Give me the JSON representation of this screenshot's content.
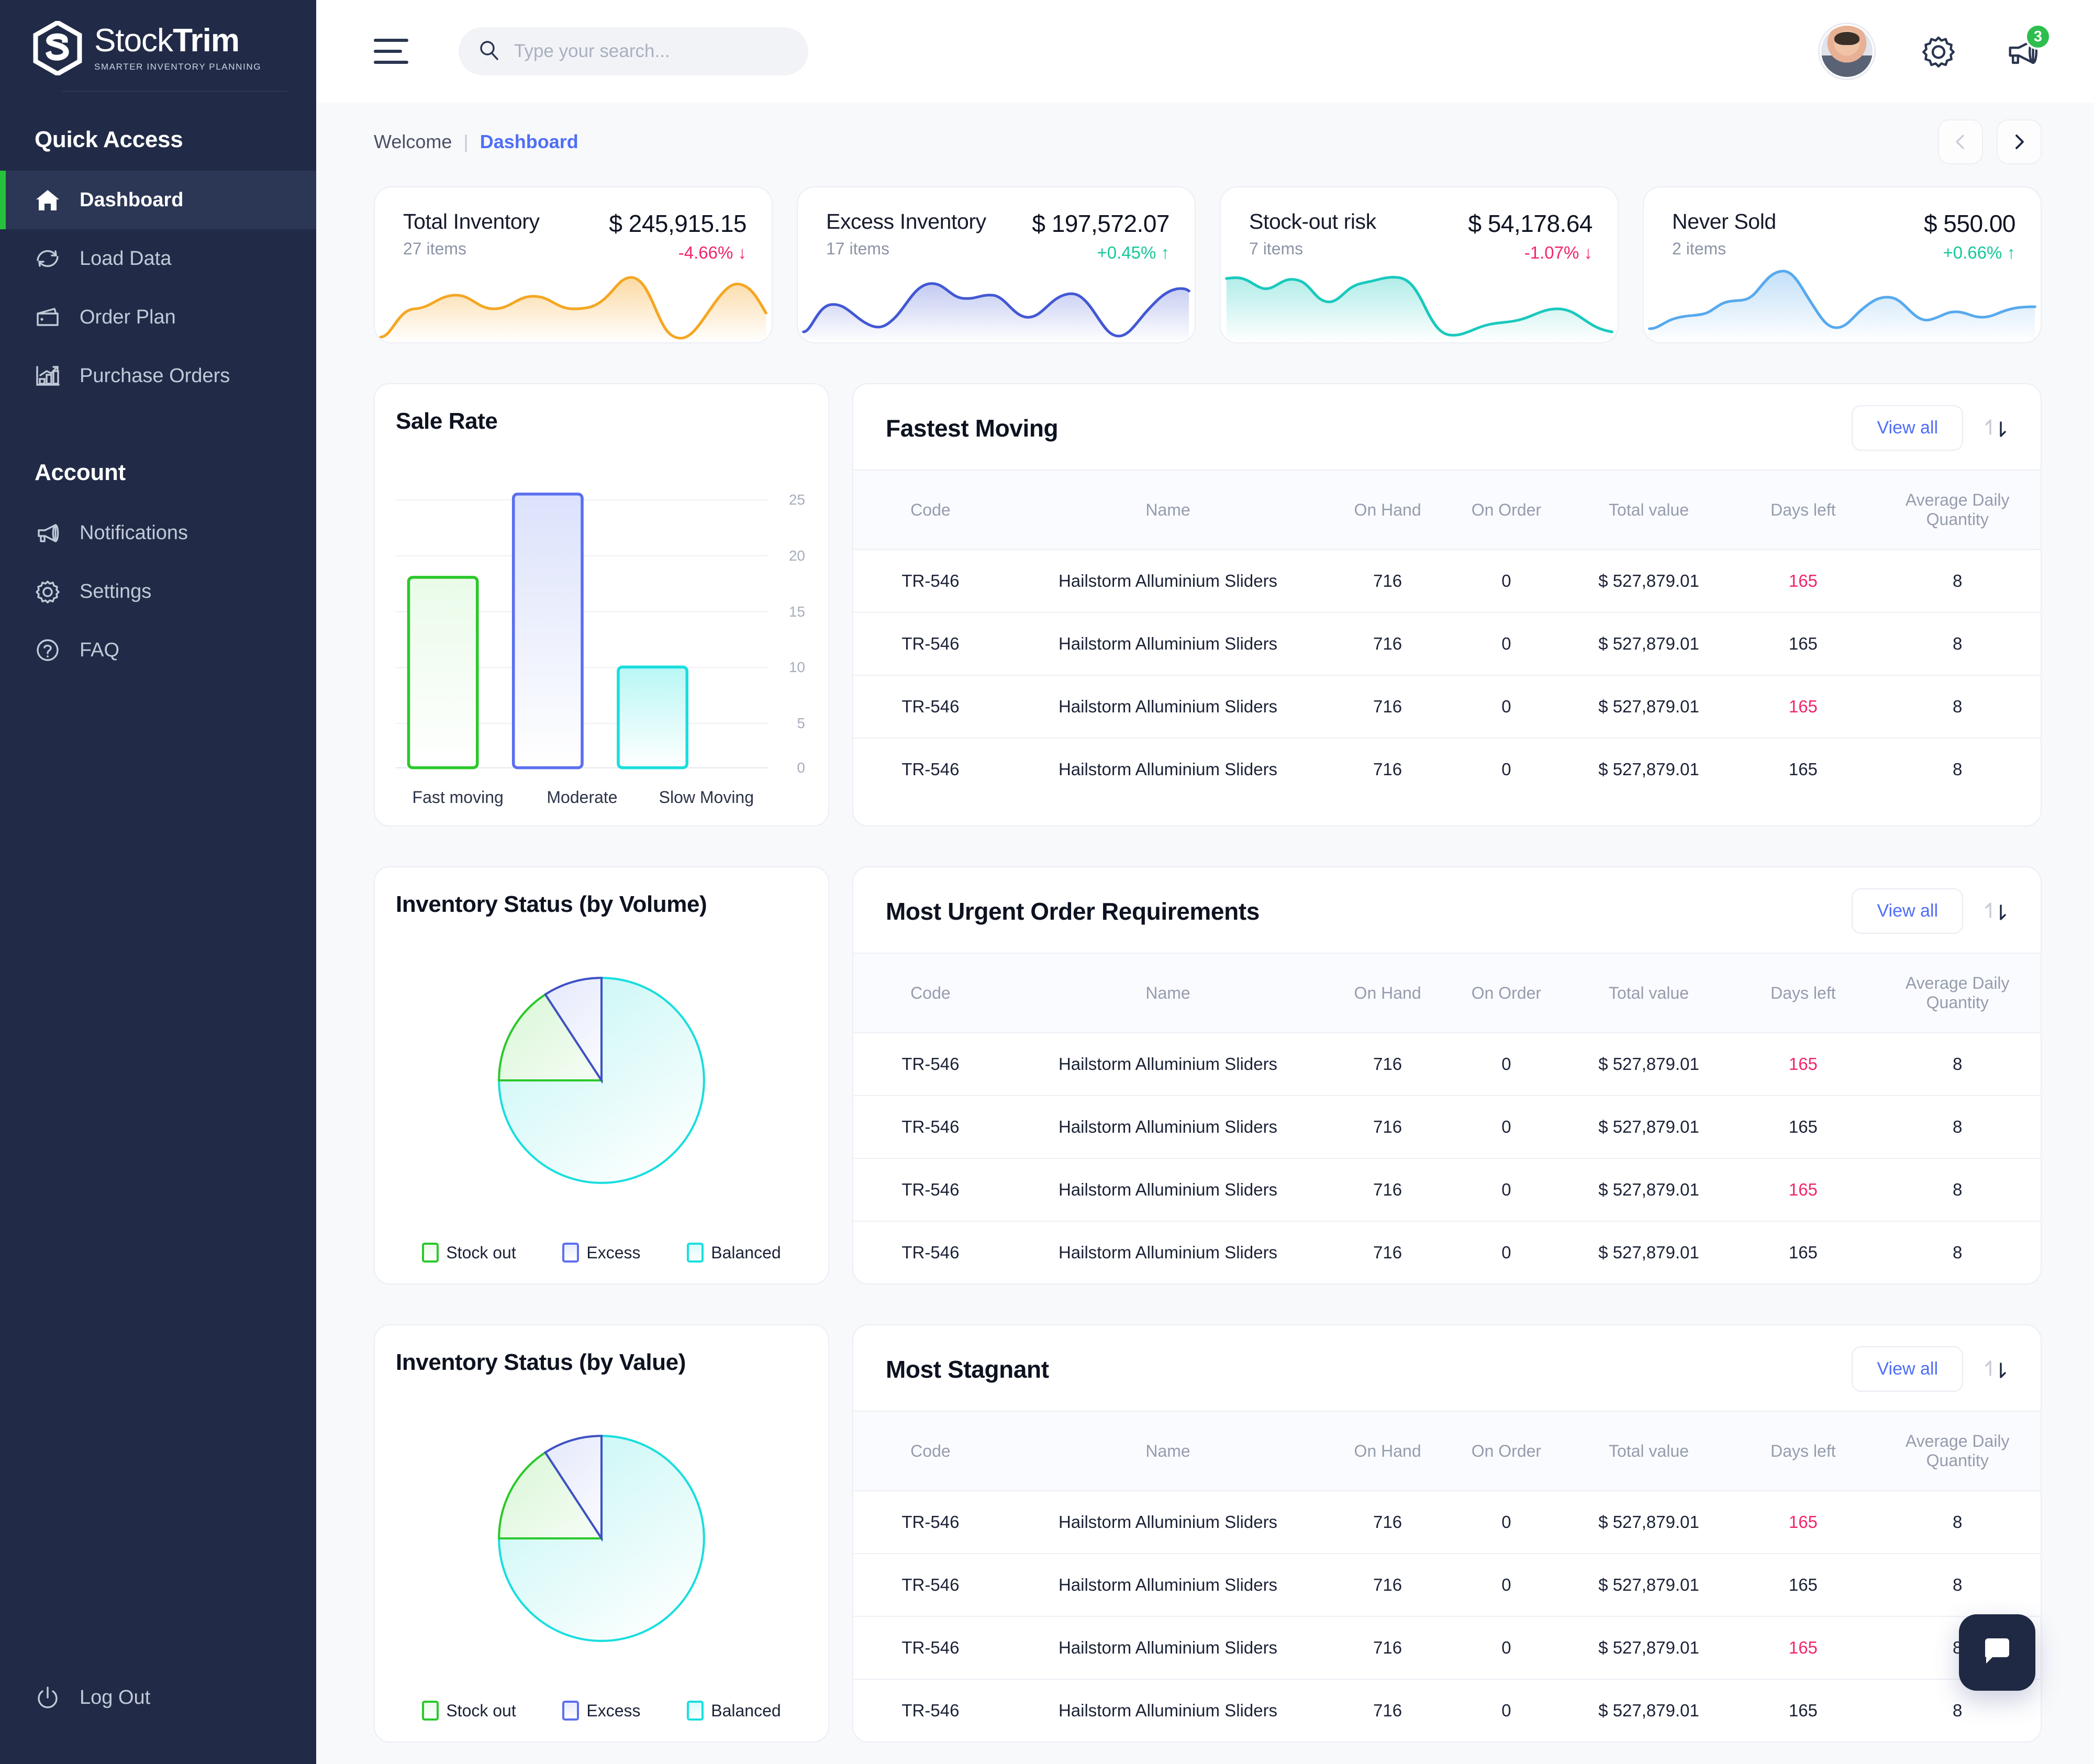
{
  "brand": {
    "name_light": "Stock",
    "name_bold": "Trim",
    "tagline": "SMARTER INVENTORY PLANNING"
  },
  "sidebar": {
    "quick_access_title": "Quick Access",
    "account_title": "Account",
    "quick_items": [
      {
        "label": "Dashboard",
        "icon": "home-icon",
        "active": true
      },
      {
        "label": "Load Data",
        "icon": "refresh-icon",
        "active": false
      },
      {
        "label": "Order Plan",
        "icon": "wallet-icon",
        "active": false
      },
      {
        "label": "Purchase Orders",
        "icon": "bar-chart-icon",
        "active": false
      }
    ],
    "account_items": [
      {
        "label": "Notifications",
        "icon": "megaphone-icon"
      },
      {
        "label": "Settings",
        "icon": "gear-icon"
      },
      {
        "label": "FAQ",
        "icon": "question-icon"
      }
    ],
    "logout_label": "Log Out"
  },
  "topbar": {
    "search_placeholder": "Type your search...",
    "search_value": "",
    "notification_count": "3"
  },
  "breadcrumb": {
    "welcome": "Welcome",
    "separator": "|",
    "current": "Dashboard"
  },
  "kpis": [
    {
      "title": "Total Inventory",
      "items": "27 items",
      "value": "$ 245,915.15",
      "delta": "-4.66% ↓",
      "delta_dir": "down",
      "color": "#f5a623"
    },
    {
      "title": "Excess Inventory",
      "items": "17 items",
      "value": "$ 197,572.07",
      "delta": "+0.45% ↑",
      "delta_dir": "up",
      "color": "#4258d4"
    },
    {
      "title": "Stock-out risk",
      "items": "7 items",
      "value": "$ 54,178.64",
      "delta": "-1.07% ↓",
      "delta_dir": "down",
      "color": "#19c9bd"
    },
    {
      "title": "Never Sold",
      "items": "2 items",
      "value": "$ 550.00",
      "delta": "+0.66% ↑",
      "delta_dir": "up",
      "color": "#57a9ee"
    }
  ],
  "colors": {
    "up": "#16c79a",
    "down": "#f2256c",
    "accent": "#4f6ef7",
    "badge": "#2dbe4e"
  },
  "table_columns": [
    "Code",
    "Name",
    "On Hand",
    "On Order",
    "Total value",
    "Days left",
    "Average Daily Quantity"
  ],
  "view_all_label": "View all",
  "panels": [
    {
      "title": "Fastest Moving",
      "rows": [
        {
          "code": "TR-546",
          "name": "Hailstorm Alluminium Sliders",
          "on_hand": "716",
          "on_order": "0",
          "total_value": "$ 527,879.01",
          "days_left": "165",
          "days_left_danger": true,
          "avg_daily_qty": "8"
        },
        {
          "code": "TR-546",
          "name": "Hailstorm Alluminium Sliders",
          "on_hand": "716",
          "on_order": "0",
          "total_value": "$ 527,879.01",
          "days_left": "165",
          "days_left_danger": false,
          "avg_daily_qty": "8"
        },
        {
          "code": "TR-546",
          "name": "Hailstorm Alluminium Sliders",
          "on_hand": "716",
          "on_order": "0",
          "total_value": "$ 527,879.01",
          "days_left": "165",
          "days_left_danger": true,
          "avg_daily_qty": "8"
        },
        {
          "code": "TR-546",
          "name": "Hailstorm Alluminium Sliders",
          "on_hand": "716",
          "on_order": "0",
          "total_value": "$ 527,879.01",
          "days_left": "165",
          "days_left_danger": false,
          "avg_daily_qty": "8"
        }
      ]
    },
    {
      "title": "Most Urgent Order Requirements",
      "rows": [
        {
          "code": "TR-546",
          "name": "Hailstorm Alluminium Sliders",
          "on_hand": "716",
          "on_order": "0",
          "total_value": "$ 527,879.01",
          "days_left": "165",
          "days_left_danger": true,
          "avg_daily_qty": "8"
        },
        {
          "code": "TR-546",
          "name": "Hailstorm Alluminium Sliders",
          "on_hand": "716",
          "on_order": "0",
          "total_value": "$ 527,879.01",
          "days_left": "165",
          "days_left_danger": false,
          "avg_daily_qty": "8"
        },
        {
          "code": "TR-546",
          "name": "Hailstorm Alluminium Sliders",
          "on_hand": "716",
          "on_order": "0",
          "total_value": "$ 527,879.01",
          "days_left": "165",
          "days_left_danger": true,
          "avg_daily_qty": "8"
        },
        {
          "code": "TR-546",
          "name": "Hailstorm Alluminium Sliders",
          "on_hand": "716",
          "on_order": "0",
          "total_value": "$ 527,879.01",
          "days_left": "165",
          "days_left_danger": false,
          "avg_daily_qty": "8"
        }
      ]
    },
    {
      "title": "Most Stagnant",
      "rows": [
        {
          "code": "TR-546",
          "name": "Hailstorm Alluminium Sliders",
          "on_hand": "716",
          "on_order": "0",
          "total_value": "$ 527,879.01",
          "days_left": "165",
          "days_left_danger": true,
          "avg_daily_qty": "8"
        },
        {
          "code": "TR-546",
          "name": "Hailstorm Alluminium Sliders",
          "on_hand": "716",
          "on_order": "0",
          "total_value": "$ 527,879.01",
          "days_left": "165",
          "days_left_danger": false,
          "avg_daily_qty": "8"
        },
        {
          "code": "TR-546",
          "name": "Hailstorm Alluminium Sliders",
          "on_hand": "716",
          "on_order": "0",
          "total_value": "$ 527,879.01",
          "days_left": "165",
          "days_left_danger": true,
          "avg_daily_qty": "8"
        },
        {
          "code": "TR-546",
          "name": "Hailstorm Alluminium Sliders",
          "on_hand": "716",
          "on_order": "0",
          "total_value": "$ 527,879.01",
          "days_left": "165",
          "days_left_danger": false,
          "avg_daily_qty": "8"
        }
      ]
    }
  ],
  "chart_data": [
    {
      "type": "bar",
      "title": "Sale Rate",
      "categories": [
        "Fast moving",
        "Moderate",
        "Slow Moving"
      ],
      "values": [
        17,
        24.5,
        9
      ],
      "colors": [
        "#2bc82b",
        "#5b6ff0",
        "#19dede"
      ],
      "ylim": [
        0,
        25
      ],
      "yticks": [
        0,
        5,
        10,
        15,
        20,
        25
      ],
      "ytick_labels": [
        "0",
        "5",
        "10",
        "15",
        "20",
        "25"
      ],
      "xlabel": "",
      "ylabel": "",
      "grid": true,
      "axis_position": "right",
      "legend": "none"
    },
    {
      "type": "pie",
      "title": "Inventory Status (by Volume)",
      "labels": [
        "Stock out",
        "Excess",
        "Balanced"
      ],
      "values": [
        17,
        8,
        75
      ],
      "colors": [
        "#2bc82b",
        "#5b6ff0",
        "#19dede"
      ],
      "legend": "bottom",
      "start_angle_deg": 0,
      "direction": "clockwise"
    },
    {
      "type": "pie",
      "title": "Inventory Status (by Value)",
      "labels": [
        "Stock out",
        "Excess",
        "Balanced"
      ],
      "values": [
        17,
        8,
        75
      ],
      "colors": [
        "#2bc82b",
        "#5b6ff0",
        "#19dede"
      ],
      "legend": "bottom",
      "start_angle_deg": 0,
      "direction": "clockwise"
    }
  ]
}
